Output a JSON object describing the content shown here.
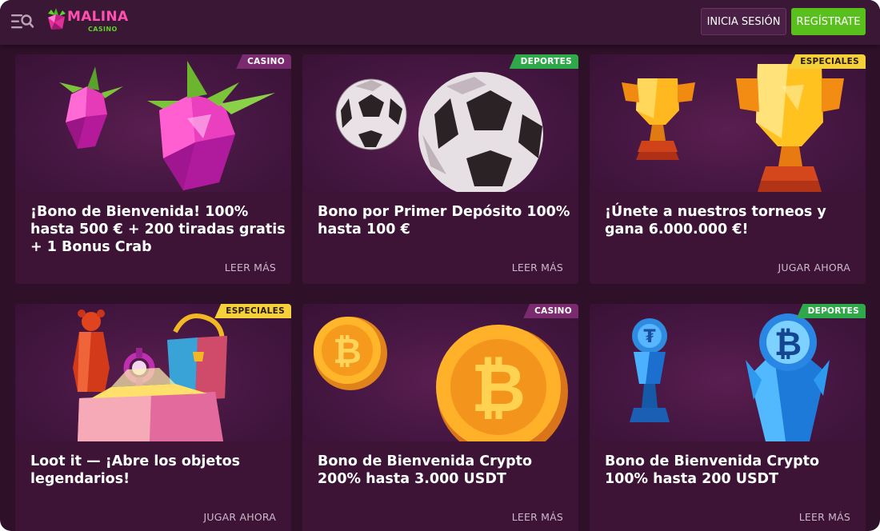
{
  "header": {
    "logo_text": "MALINA",
    "logo_sub": "CASINO",
    "login_label": "INICIA SESIÓN",
    "register_label": "REGÍSTRATE"
  },
  "colors": {
    "background": "#2e1029",
    "card": "#3d1436",
    "brand_pink": "#ff4fb0",
    "register_green": "#58bf1c",
    "badge_casino": "#7a2a6e",
    "badge_deportes": "#2fa84a",
    "badge_especiales": "#f4d13a"
  },
  "cards": [
    {
      "badge": "CASINO",
      "title": "¡Bono de Bienvenida! 100% hasta 500 € + 200 tiradas gratis + 1 Bonus Crab",
      "action": "LEER MÁS",
      "art": "raspberry-gems-icon"
    },
    {
      "badge": "DEPORTES",
      "title": "Bono por Primer Depósito 100% hasta 100 €",
      "action": "LEER MÁS",
      "art": "soccer-balls-icon"
    },
    {
      "badge": "ESPECIALES",
      "title": "¡Únete a nuestros torneos y gana 6.000.000 €!",
      "action": "JUGAR AHORA",
      "art": "trophies-icon"
    },
    {
      "badge": "ESPECIALES",
      "title": "Loot it — ¡Abre los objetos legendarios!",
      "action": "JUGAR AHORA",
      "art": "loot-box-icon"
    },
    {
      "badge": "CASINO",
      "title": "Bono de Bienvenida Crypto 200% hasta 3.000 USDT",
      "action": "LEER MÁS",
      "art": "bitcoin-coins-icon"
    },
    {
      "badge": "DEPORTES",
      "title": "Bono de Bienvenida Crypto 100% hasta 200 USDT",
      "action": "LEER MÁS",
      "art": "crypto-trophies-icon"
    }
  ]
}
